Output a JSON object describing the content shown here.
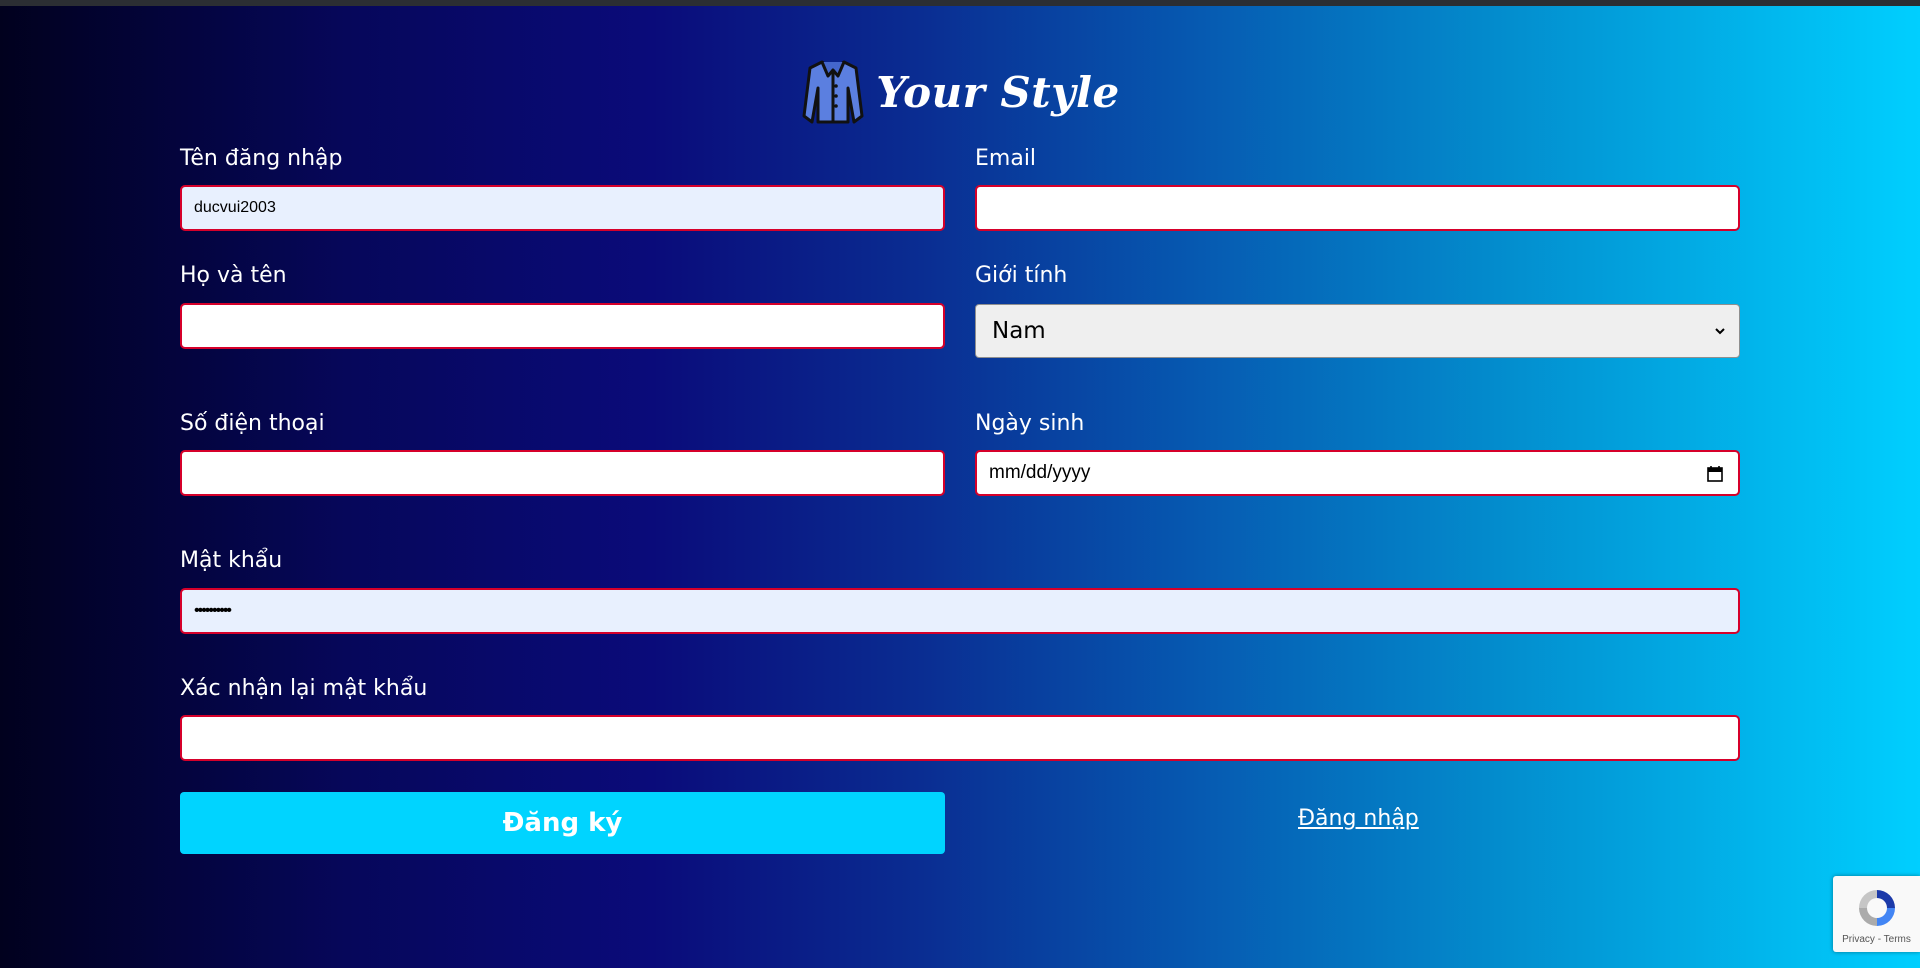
{
  "brand": {
    "title": "Your Style",
    "icon": "jacket-icon"
  },
  "form": {
    "username": {
      "label": "Tên đăng nhập",
      "value": "ducvui2003"
    },
    "email": {
      "label": "Email",
      "value": ""
    },
    "fullname": {
      "label": "Họ và tên",
      "value": ""
    },
    "gender": {
      "label": "Giới tính",
      "selected": "Nam"
    },
    "phone": {
      "label": "Số điện thoại",
      "value": ""
    },
    "birthday": {
      "label": "Ngày sinh",
      "placeholder": "mm/dd/yyyy"
    },
    "password": {
      "label": "Mật khẩu",
      "masked": "••••••••••"
    },
    "confirm_password": {
      "label": "Xác nhận lại mật khẩu",
      "value": ""
    }
  },
  "actions": {
    "register_label": "Đăng ký",
    "login_label": "Đăng nhập"
  },
  "recaptcha": {
    "privacy": "Privacy",
    "separator": "-",
    "terms": "Terms"
  },
  "colors": {
    "accent": "#00d4ff",
    "field_border": "#d6002a",
    "autofill_bg": "#e8f0fe"
  }
}
